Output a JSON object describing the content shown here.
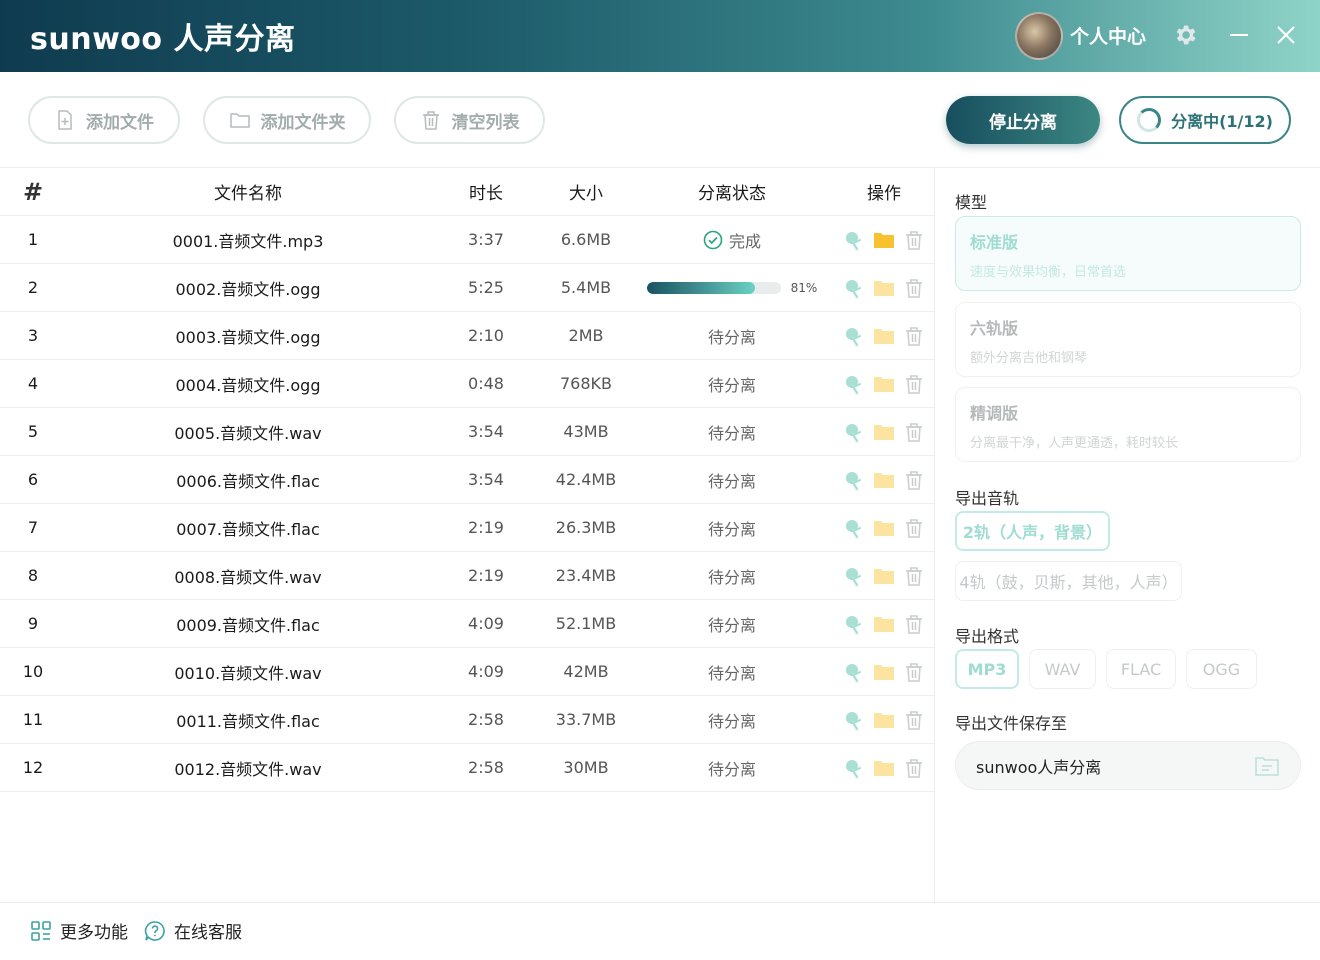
{
  "titlebar": {
    "app_title": "sunwoo 人声分离",
    "user_center": "个人中心"
  },
  "toolbar": {
    "add_file": "添加文件",
    "add_folder": "添加文件夹",
    "clear_list": "清空列表",
    "stop": "停止分离",
    "progress": "分离中(1/12)"
  },
  "table": {
    "headers": {
      "num": "#",
      "name": "文件名称",
      "duration": "时长",
      "size": "大小",
      "status": "分离状态",
      "ops": "操作"
    },
    "rows": [
      {
        "num": "1",
        "name": "0001.音频文件.mp3",
        "duration": "3:37",
        "size": "6.6MB",
        "status": "完成",
        "state": "done"
      },
      {
        "num": "2",
        "name": "0002.音频文件.ogg",
        "duration": "5:25",
        "size": "5.4MB",
        "status": "81%",
        "state": "progress",
        "progress": 0.81
      },
      {
        "num": "3",
        "name": "0003.音频文件.ogg",
        "duration": "2:10",
        "size": "2MB",
        "status": "待分离",
        "state": "pending"
      },
      {
        "num": "4",
        "name": "0004.音频文件.ogg",
        "duration": "0:48",
        "size": "768KB",
        "status": "待分离",
        "state": "pending"
      },
      {
        "num": "5",
        "name": "0005.音频文件.wav",
        "duration": "3:54",
        "size": "43MB",
        "status": "待分离",
        "state": "pending"
      },
      {
        "num": "6",
        "name": "0006.音频文件.flac",
        "duration": "3:54",
        "size": "42.4MB",
        "status": "待分离",
        "state": "pending"
      },
      {
        "num": "7",
        "name": "0007.音频文件.flac",
        "duration": "2:19",
        "size": "26.3MB",
        "status": "待分离",
        "state": "pending"
      },
      {
        "num": "8",
        "name": "0008.音频文件.wav",
        "duration": "2:19",
        "size": "23.4MB",
        "status": "待分离",
        "state": "pending"
      },
      {
        "num": "9",
        "name": "0009.音频文件.flac",
        "duration": "4:09",
        "size": "52.1MB",
        "status": "待分离",
        "state": "pending"
      },
      {
        "num": "10",
        "name": "0010.音频文件.wav",
        "duration": "4:09",
        "size": "42MB",
        "status": "待分离",
        "state": "pending"
      },
      {
        "num": "11",
        "name": "0011.音频文件.flac",
        "duration": "2:58",
        "size": "33.7MB",
        "status": "待分离",
        "state": "pending"
      },
      {
        "num": "12",
        "name": "0012.音频文件.wav",
        "duration": "2:58",
        "size": "30MB",
        "status": "待分离",
        "state": "pending"
      }
    ]
  },
  "panel": {
    "model_label": "模型",
    "models": [
      {
        "title": "标准版",
        "desc": "速度与效果均衡，日常首选",
        "selected": true
      },
      {
        "title": "六轨版",
        "desc": "额外分离吉他和钢琴",
        "selected": false
      },
      {
        "title": "精调版",
        "desc": "分离最干净，人声更通透，耗时较长",
        "selected": false
      }
    ],
    "tracks_label": "导出音轨",
    "tracks": [
      {
        "label": "2轨（人声，背景）",
        "selected": true
      },
      {
        "label": "4轨（鼓，贝斯，其他，人声）",
        "selected": false
      }
    ],
    "format_label": "导出格式",
    "formats": [
      {
        "label": "MP3",
        "selected": true
      },
      {
        "label": "WAV",
        "selected": false
      },
      {
        "label": "FLAC",
        "selected": false
      },
      {
        "label": "OGG",
        "selected": false
      }
    ],
    "save_label": "导出文件保存至",
    "save_path": "sunwoo人声分离"
  },
  "footer": {
    "more": "更多功能",
    "support": "在线客服"
  },
  "colors": {
    "accent": "#2d7276",
    "accent_light": "#9fdcd2",
    "folder": "#f7c22e",
    "done": "#2aa57c"
  }
}
